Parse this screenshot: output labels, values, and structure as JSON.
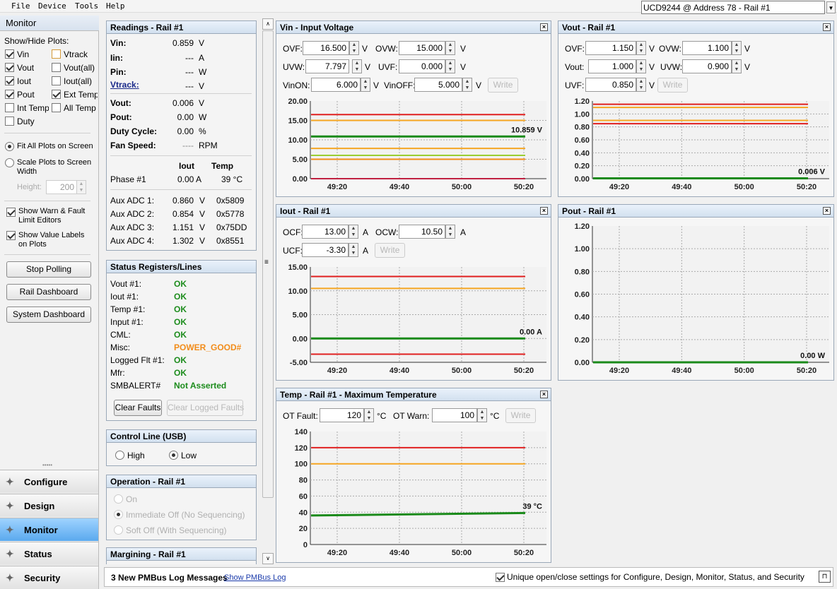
{
  "menu": [
    "File",
    "Device",
    "Tools",
    "Help"
  ],
  "device_selector": "UCD9244 @ Address 78 - Rail #1",
  "sidebar": {
    "title": "Monitor",
    "show_hide_label": "Show/Hide Plots:",
    "plots": [
      {
        "label": "Vin",
        "checked": true
      },
      {
        "label": "Vtrack",
        "checked": false
      },
      {
        "label": "Vout",
        "checked": true
      },
      {
        "label": "Vout(all)",
        "checked": false
      },
      {
        "label": "Iout",
        "checked": true
      },
      {
        "label": "Iout(all)",
        "checked": false
      },
      {
        "label": "Pout",
        "checked": true
      },
      {
        "label": "Ext Temp",
        "checked": true
      },
      {
        "label": "Int Temp",
        "checked": false
      },
      {
        "label": "All Temp",
        "checked": false
      },
      {
        "label": "Duty",
        "checked": false
      }
    ],
    "fit_all": "Fit All Plots on Screen",
    "scale_plots_1": "Scale Plots to Screen",
    "scale_plots_2": "Width",
    "height_label": "Height:",
    "height_value": "200",
    "show_warn_1": "Show Warn & Fault",
    "show_warn_2": "Limit Editors",
    "show_value_1": "Show Value Labels",
    "show_value_2": "on Plots",
    "stop_polling": "Stop Polling",
    "rail_dashboard": "Rail Dashboard",
    "system_dashboard": "System Dashboard",
    "nav": [
      "Configure",
      "Design",
      "Monitor",
      "Status",
      "Security"
    ]
  },
  "readings": {
    "title": "Readings - Rail #1",
    "rows": [
      {
        "label": "Vin:",
        "value": "0.859",
        "unit": "V"
      },
      {
        "label": "Iin:",
        "value": "---",
        "unit": "A"
      },
      {
        "label": "Pin:",
        "value": "---",
        "unit": "W"
      },
      {
        "label": "Vtrack:",
        "value": "---",
        "unit": "V"
      },
      {
        "label": "Vout:",
        "value": "0.006",
        "unit": "V"
      },
      {
        "label": "Pout:",
        "value": "0.00",
        "unit": "W"
      },
      {
        "label": "Duty Cycle:",
        "value": "0.00",
        "unit": "%"
      },
      {
        "label": "Fan Speed:",
        "value": "----",
        "unit": "RPM"
      }
    ],
    "iout_header": "Iout",
    "temp_header": "Temp",
    "phase_label": "Phase #1",
    "phase_iout": "0.00 A",
    "phase_temp": "39 °C",
    "aux": [
      {
        "label": "Aux ADC 1:",
        "value": "0.860",
        "unit": "V",
        "hex": "0x5809"
      },
      {
        "label": "Aux ADC 2:",
        "value": "0.854",
        "unit": "V",
        "hex": "0x5778"
      },
      {
        "label": "Aux ADC 3:",
        "value": "1.151",
        "unit": "V",
        "hex": "0x75DD"
      },
      {
        "label": "Aux ADC 4:",
        "value": "1.302",
        "unit": "V",
        "hex": "0x8551"
      }
    ]
  },
  "status": {
    "title": "Status Registers/Lines",
    "rows": [
      {
        "label": "Vout #1:",
        "value": "OK"
      },
      {
        "label": "Iout #1:",
        "value": "OK"
      },
      {
        "label": "Temp #1:",
        "value": "OK"
      },
      {
        "label": "Input #1:",
        "value": "OK"
      },
      {
        "label": "CML:",
        "value": "OK"
      },
      {
        "label": "Misc:",
        "value": "POWER_GOOD#"
      },
      {
        "label": "Logged Flt #1:",
        "value": "OK"
      },
      {
        "label": "Mfr:",
        "value": "OK"
      },
      {
        "label": "SMBALERT#",
        "value": "Not Asserted"
      }
    ],
    "clear_faults": "Clear Faults",
    "clear_logged": "Clear Logged Faults"
  },
  "control_line": {
    "title": "Control Line (USB)",
    "high": "High",
    "low": "Low"
  },
  "operation": {
    "title": "Operation - Rail #1",
    "on": "On",
    "immediate": "Immediate Off (No Sequencing)",
    "soft": "Soft Off (With Sequencing)"
  },
  "margining": {
    "title": "Margining - Rail #1"
  },
  "vin_panel": {
    "title": "Vin - Input Voltage",
    "ovf_label": "OVF:",
    "ovf": "16.500",
    "ovw_label": "OVW:",
    "ovw": "15.000",
    "uvw_label": "UVW:",
    "uvw": "7.797",
    "uvf_label": "UVF:",
    "uvf": "0.000",
    "vinon_label": "VinON:",
    "vinon": "6.000",
    "vinoff_label": "VinOFF:",
    "vinoff": "5.000",
    "unit": "V",
    "write": "Write"
  },
  "vout_panel": {
    "title": "Vout - Rail #1",
    "ovf_label": "OVF:",
    "ovf": "1.150",
    "ovw_label": "OVW:",
    "ovw": "1.100",
    "vout_label": "Vout:",
    "vout": "1.000",
    "uvw_label": "UVW:",
    "uvw": "0.900",
    "uvf_label": "UVF:",
    "uvf": "0.850",
    "unit": "V",
    "write": "Write"
  },
  "iout_panel": {
    "title": "Iout - Rail #1",
    "ocf_label": "OCF:",
    "ocf": "13.00",
    "ocw_label": "OCW:",
    "ocw": "10.50",
    "ucf_label": "UCF:",
    "ucf": "-3.30",
    "unit": "A",
    "write": "Write"
  },
  "pout_panel": {
    "title": "Pout - Rail #1"
  },
  "temp_panel": {
    "title": "Temp - Rail #1 - Maximum Temperature",
    "otf_label": "OT Fault:",
    "otf": "120",
    "otw_label": "OT Warn:",
    "otw": "100",
    "unit": "°C",
    "write": "Write"
  },
  "chart_data": [
    {
      "name": "vin",
      "type": "line",
      "x_ticks": [
        "49:20",
        "49:40",
        "50:00",
        "50:20"
      ],
      "ylim": [
        0,
        20
      ],
      "y_ticks": [
        "20.00",
        "15.00",
        "10.00",
        "5.00",
        "0.00"
      ],
      "limit_lines": [
        {
          "value": 16.5,
          "color": "#e02020"
        },
        {
          "value": 15.0,
          "color": "#f5a623"
        },
        {
          "value": 7.797,
          "color": "#f5a623"
        },
        {
          "value": 6.0,
          "color": "#9acd32"
        },
        {
          "value": 5.0,
          "color": "#f28c1a"
        },
        {
          "value": 0.0,
          "color": "#c02040"
        }
      ],
      "series": {
        "value": 10.859,
        "color": "#1a8a1a"
      },
      "value_label": "10.859 V"
    },
    {
      "name": "vout",
      "type": "line",
      "x_ticks": [
        "49:20",
        "49:40",
        "50:00",
        "50:20"
      ],
      "ylim": [
        0,
        1.2
      ],
      "y_ticks": [
        "1.20",
        "1.00",
        "0.80",
        "0.60",
        "0.40",
        "0.20",
        "0.00"
      ],
      "limit_lines": [
        {
          "value": 1.15,
          "color": "#e02020"
        },
        {
          "value": 1.1,
          "color": "#f5a623"
        },
        {
          "value": 0.9,
          "color": "#f5a623"
        },
        {
          "value": 0.85,
          "color": "#e02020"
        }
      ],
      "series": {
        "value": 0.006,
        "color": "#1a8a1a"
      },
      "value_label": "0.006 V"
    },
    {
      "name": "iout",
      "type": "line",
      "x_ticks": [
        "49:20",
        "49:40",
        "50:00",
        "50:20"
      ],
      "ylim": [
        -5,
        15
      ],
      "y_ticks": [
        "15.00",
        "10.00",
        "5.00",
        "0.00",
        "-5.00"
      ],
      "limit_lines": [
        {
          "value": 13.0,
          "color": "#e02020"
        },
        {
          "value": 10.5,
          "color": "#f5a623"
        },
        {
          "value": -3.3,
          "color": "#e02020"
        }
      ],
      "series": {
        "value": 0.0,
        "color": "#1a8a1a"
      },
      "value_label": "0.00 A"
    },
    {
      "name": "pout",
      "type": "line",
      "x_ticks": [
        "49:20",
        "49:40",
        "50:00",
        "50:20"
      ],
      "ylim": [
        0,
        1.2
      ],
      "y_ticks": [
        "1.20",
        "1.00",
        "0.80",
        "0.60",
        "0.40",
        "0.20",
        "0.00"
      ],
      "limit_lines": [],
      "series": {
        "value": 0.0,
        "color": "#1a8a1a"
      },
      "value_label": "0.00 W"
    },
    {
      "name": "temp",
      "type": "line",
      "x_ticks": [
        "49:20",
        "49:40",
        "50:00",
        "50:20"
      ],
      "ylim": [
        0,
        140
      ],
      "y_ticks": [
        "140",
        "120",
        "100",
        "80",
        "60",
        "40",
        "20",
        "0"
      ],
      "limit_lines": [
        {
          "value": 120,
          "color": "#e02020"
        },
        {
          "value": 100,
          "color": "#f5a623"
        }
      ],
      "series": {
        "value_start": 36,
        "value": 39,
        "color": "#1a8a1a"
      },
      "value_label": "39 °C"
    }
  ],
  "statusbar": {
    "log_msg": "3 New PMBus Log Messages",
    "show_log": "Show PMBus Log",
    "unique": "Unique open/close settings for Configure, Design, Monitor, Status, and Security"
  }
}
